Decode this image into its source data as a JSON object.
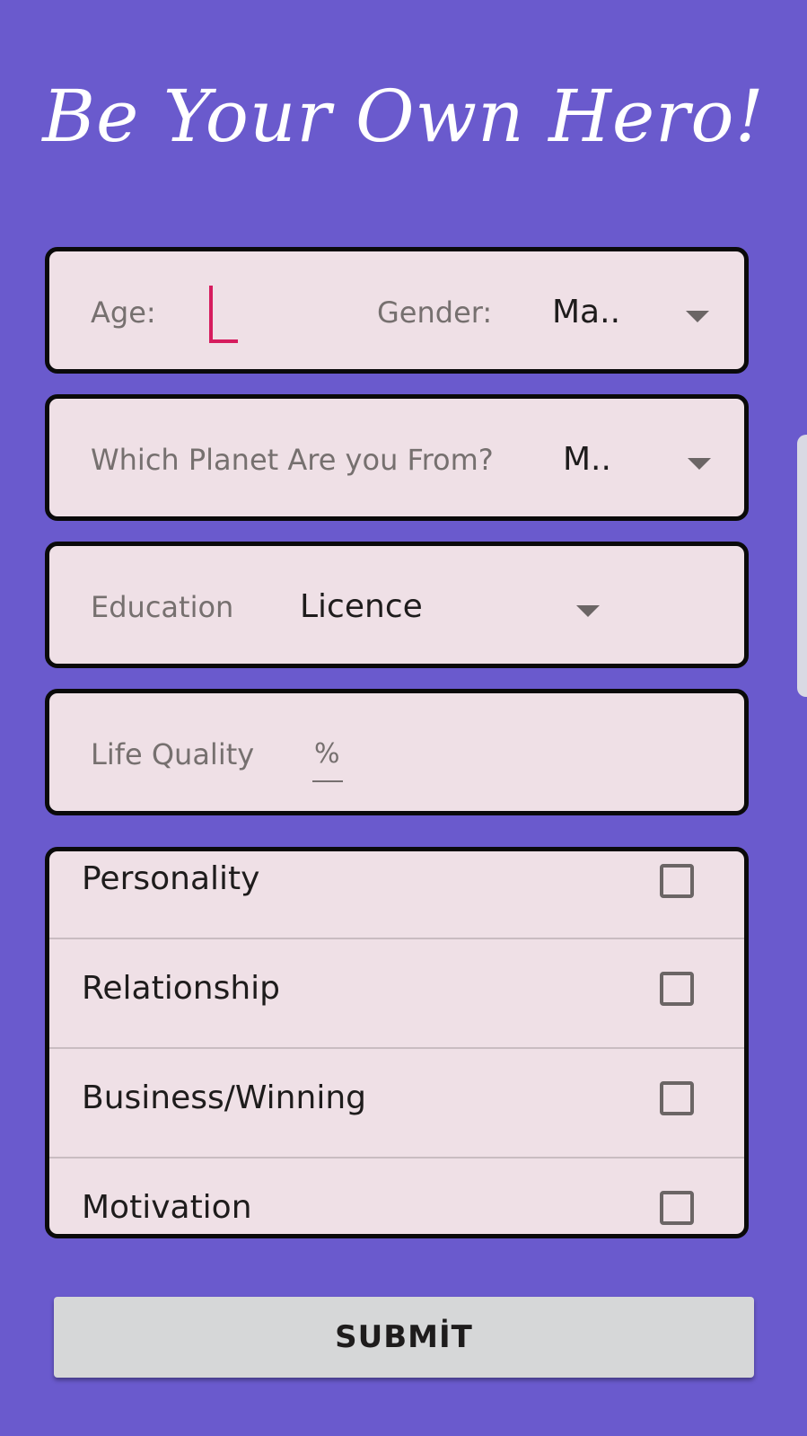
{
  "header": {
    "title": "Be Your Own Hero!"
  },
  "row_age_gender": {
    "age_label": "Age:",
    "age_value": "",
    "gender_label": "Gender:",
    "gender_value": "Ma.."
  },
  "row_planet": {
    "label": "Which Planet Are you From?",
    "value": "M.."
  },
  "row_education": {
    "label": "Education",
    "value": "Licence"
  },
  "row_life_quality": {
    "label": "Life Quality",
    "placeholder": "%"
  },
  "interests": [
    {
      "label": "Personality",
      "checked": false
    },
    {
      "label": "Relationship",
      "checked": false
    },
    {
      "label": "Business/Winning",
      "checked": false
    },
    {
      "label": "Motivation",
      "checked": false
    }
  ],
  "submit": {
    "label": "SUBMİT"
  },
  "colors": {
    "background": "#6a5acd",
    "card": "#efe0e6",
    "accent_cursor": "#d61c5e",
    "button": "#d6d7d8"
  }
}
